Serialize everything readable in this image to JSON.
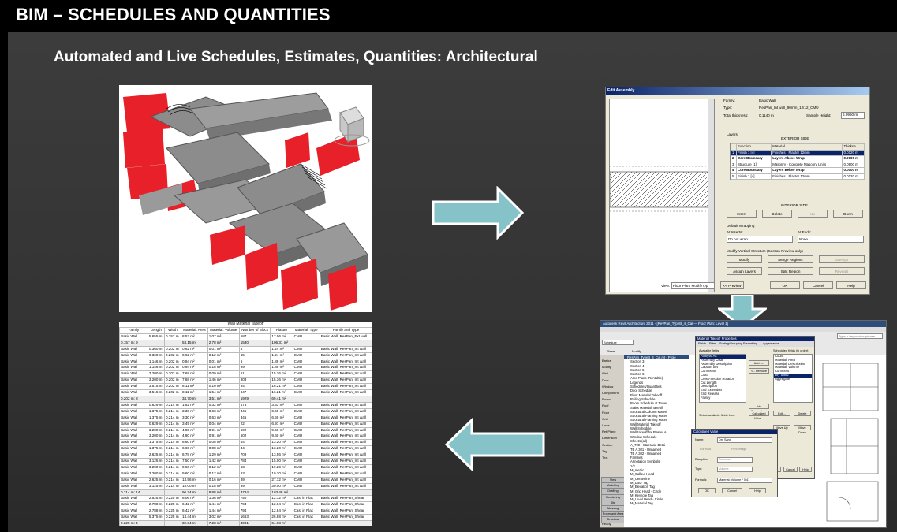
{
  "slide": {
    "title": "BIM – SCHEDULES AND QUANTITIES",
    "subtitle": "Automated and Live Schedules, Estimates, Quantities: Architectural"
  },
  "schedule": {
    "title": "Wall Material Takeoff",
    "headers": [
      "Family",
      "Length",
      "Width",
      "Material: Area",
      "Material: Volume",
      "Number of Block",
      "Plaster",
      "Material: Type",
      "Family and Type"
    ],
    "rows": [
      [
        "Basic Wall",
        "5.655 m",
        "0.157 m",
        "8.53 m²",
        "1.07 m³",
        "587",
        "17.06 m²",
        "CMU",
        "Basic Wall: ResPan_Ext wall"
      ],
      [
        "0.157 m: 9",
        "",
        "",
        "53.15 m²",
        "2.78 m³",
        "1530",
        "106.31 m²",
        "",
        ""
      ],
      [
        "Basic Wall",
        "0.360 m",
        "0.202 m",
        "0.62 m²",
        "0.01 m³",
        "4",
        "1.24 m²",
        "CMU",
        "Basic Wall: ResPan_Int wall"
      ],
      [
        "Basic Wall",
        "0.360 m",
        "0.202 m",
        "0.62 m²",
        "0.12 m³",
        "65",
        "1.24 m²",
        "CMU",
        "Basic Wall: ResPan_Int wall"
      ],
      [
        "Basic Wall",
        "1.146 m",
        "0.202 m",
        "0.94 m²",
        "0.01 m³",
        "6",
        "1.89 m²",
        "CMU",
        "Basic Wall: ResPan_Int wall"
      ],
      [
        "Basic Wall",
        "1.146 m",
        "0.202 m",
        "0.94 m²",
        "0.18 m³",
        "99",
        "1.89 m²",
        "CMU",
        "Basic Wall: ResPan_Int wall"
      ],
      [
        "Basic Wall",
        "3.200 m",
        "0.202 m",
        "7.68 m²",
        "0.09 m³",
        "51",
        "15.36 m²",
        "CMU",
        "Basic Wall: ResPan_Int wall"
      ],
      [
        "Basic Wall",
        "3.200 m",
        "0.202 m",
        "7.68 m²",
        "1.46 m³",
        "803",
        "15.36 m²",
        "CMU",
        "Basic Wall: ResPan_Int wall"
      ],
      [
        "Basic Wall",
        "3.515 m",
        "0.202 m",
        "8.11 m²",
        "0.10 m³",
        "54",
        "16.21 m²",
        "CMU",
        "Basic Wall: ResPan_Int wall"
      ],
      [
        "Basic Wall",
        "3.515 m",
        "0.202 m",
        "8.11 m²",
        "1.54 m³",
        "847",
        "16.21 m²",
        "CMU",
        "Basic Wall: ResPan_Int wall"
      ],
      [
        "0.202 m: 8",
        "",
        "",
        "34.70 m²",
        "3.51 m³",
        "1929",
        "69.41 m²",
        "",
        ""
      ],
      [
        "Basic Wall",
        "0.629 m",
        "0.214 m",
        "1.82 m²",
        "0.32 m³",
        "173",
        "3.63 m²",
        "CMU",
        "Basic Wall: ResPan_Int wall"
      ],
      [
        "Basic Wall",
        "1.375 m",
        "0.214 m",
        "3.30 m²",
        "0.63 m³",
        "345",
        "6.60 m²",
        "CMU",
        "Basic Wall: ResPan_Int wall"
      ],
      [
        "Basic Wall",
        "1.375 m",
        "0.214 m",
        "3.30 m²",
        "0.63 m³",
        "345",
        "6.60 m²",
        "CMU",
        "Basic Wall: ResPan_Int wall"
      ],
      [
        "Basic Wall",
        "0.629 m",
        "0.214 m",
        "3.49 m²",
        "0.04 m³",
        "22",
        "6.97 m²",
        "CMU",
        "Basic Wall: ResPan_Int wall"
      ],
      [
        "Basic Wall",
        "3.200 m",
        "0.214 m",
        "4.80 m²",
        "0.91 m³",
        "502",
        "9.60 m²",
        "CMU",
        "Basic Wall: ResPan_Int wall"
      ],
      [
        "Basic Wall",
        "3.200 m",
        "0.214 m",
        "4.80 m²",
        "0.91 m³",
        "502",
        "9.60 m²",
        "CMU",
        "Basic Wall: ResPan_Int wall"
      ],
      [
        "Basic Wall",
        "1.375 m",
        "0.214 m",
        "6.60 m²",
        "0.08 m³",
        "44",
        "13.20 m²",
        "CMU",
        "Basic Wall: ResPan_Int wall"
      ],
      [
        "Basic Wall",
        "1.375 m",
        "0.214 m",
        "6.60 m²",
        "0.08 m³",
        "44",
        "13.20 m²",
        "CMU",
        "Basic Wall: ResPan_Int wall"
      ],
      [
        "Basic Wall",
        "2.625 m",
        "0.214 m",
        "6.78 m²",
        "1.29 m³",
        "709",
        "13.56 m²",
        "CMU",
        "Basic Wall: ResPan_Int wall"
      ],
      [
        "Basic Wall",
        "3.125 m",
        "0.214 m",
        "7.50 m²",
        "1.42 m³",
        "784",
        "15.00 m²",
        "CMU",
        "Basic Wall: ResPan_Int wall"
      ],
      [
        "Basic Wall",
        "3.200 m",
        "0.214 m",
        "9.60 m²",
        "0.12 m³",
        "63",
        "19.20 m²",
        "CMU",
        "Basic Wall: ResPan_Int wall"
      ],
      [
        "Basic Wall",
        "3.200 m",
        "0.214 m",
        "9.60 m²",
        "0.12 m³",
        "63",
        "19.20 m²",
        "CMU",
        "Basic Wall: ResPan_Int wall"
      ],
      [
        "Basic Wall",
        "2.625 m",
        "0.214 m",
        "13.56 m²",
        "0.16 m³",
        "89",
        "27.12 m²",
        "CMU",
        "Basic Wall: ResPan_Int wall"
      ],
      [
        "Basic Wall",
        "3.125 m",
        "0.214 m",
        "15.00 m²",
        "0.18 m³",
        "99",
        "30.00 m²",
        "CMU",
        "Basic Wall: ResPan_Int wall"
      ],
      [
        "0.214 m: 14",
        "",
        "",
        "96.74 m²",
        "8.88 m³",
        "3784",
        "193.48 m²",
        "",
        ""
      ],
      [
        "Basic Wall",
        "2.525 m",
        "0.225 m",
        "6.06 m²",
        "1.36 m³",
        "750",
        "12.12 m²",
        "Cast in Plac",
        "Basic Wall: ResPan_Shear"
      ],
      [
        "Basic Wall",
        "2.788 m",
        "0.225 m",
        "6.42 m²",
        "1.44 m³",
        "794",
        "12.84 m²",
        "Cast in Plac",
        "Basic Wall: ResPan_Shear"
      ],
      [
        "Basic Wall",
        "2.788 m",
        "0.225 m",
        "6.42 m²",
        "1.44 m³",
        "794",
        "12.84 m²",
        "Cast in Plac",
        "Basic Wall: ResPan_Shear"
      ],
      [
        "Basic Wall",
        "5.375 m",
        "0.225 m",
        "13.44 m²",
        "3.02 m³",
        "1663",
        "26.88 m²",
        "Cast in Plac",
        "Basic Wall: ResPan_Shear"
      ],
      [
        "0.225 m: 4",
        "",
        "",
        "32.34 m²",
        "7.28 m³",
        "4001",
        "64.68 m²",
        "",
        ""
      ],
      [
        "Grand total: 97",
        "",
        "",
        "688.76 m²",
        "43.77 m³",
        "24075",
        "1377.51 m²",
        "",
        ""
      ]
    ]
  },
  "edit_assembly": {
    "caption": "Edit Assembly",
    "family_label": "Family:",
    "family_value": "Basic Wall",
    "type_label": "Type:",
    "type_value": "ResPan_Int wall_90mm_12/12_CMU",
    "thickness_label": "Total thickness:",
    "thickness_value": "0.1140 m",
    "sample_label": "Sample Height:",
    "sample_value": "6.0960 m",
    "layers_label": "Layers",
    "exterior_side": "EXTERIOR SIDE",
    "interior_side": "INTERIOR SIDE",
    "layer_headers": [
      "",
      "Function",
      "Material",
      "Thickne"
    ],
    "layers": [
      [
        "1",
        "Finish 1 [4]",
        "Finishes - Plaster 12mm",
        "0.0120 m"
      ],
      [
        "2",
        "Core Boundary",
        "Layers Above Wrap",
        "0.0000 m"
      ],
      [
        "3",
        "Structure [1]",
        "Masonry - Concrete Masonry Units",
        "0.0900 m"
      ],
      [
        "4",
        "Core Boundary",
        "Layers Below Wrap",
        "0.0000 m"
      ],
      [
        "5",
        "Finish 1 [4]",
        "Finishes - Plaster 12mm",
        "0.0120 m"
      ]
    ],
    "insert": "Insert",
    "delete": "Delete",
    "up": "Up",
    "down": "Down",
    "default_wrapping": "Default Wrapping",
    "at_inserts_label": "At Inserts:",
    "at_inserts_value": "Do not wrap",
    "at_ends_label": "At Ends:",
    "at_ends_value": "None",
    "modify_vertical": "Modify Vertical Structure (Section Preview only)",
    "modify": "Modify",
    "merge_regions": "Merge Regions",
    "sweeps": "Sweeps",
    "assign_layers": "Assign Layers",
    "split_region": "Split Region",
    "reveals": "Reveals",
    "view_label": "View:",
    "view_value": "Floor Plan: Modify typ",
    "preview": "<< Preview",
    "ok": "OK",
    "cancel": "Cancel",
    "help": "Help"
  },
  "revit": {
    "title": "Autodesk Revit Architecture 2011 - [RevPan_TypeB_4_Cal — Floor Plan: Level 1]",
    "search": "Type a keyword or phrase",
    "schedule_combo": "Schedule",
    "family_label": "Family:",
    "family_value": "System Family: Schedule",
    "toolbar": [
      "Plane",
      "Modify"
    ],
    "left_tools": [
      "Basics",
      "Modify",
      "Wall",
      "Door",
      "Window",
      "Component",
      "Room",
      "Roof",
      "Floor",
      "Grid",
      "Lines",
      "Ref Plane",
      "Dimension",
      "Section",
      "Tag",
      "Text"
    ],
    "left_tabs": [
      "View",
      "Modelling",
      "Drafting",
      "Rendering",
      "Site",
      "Massing",
      "Room and Area",
      "Structural"
    ],
    "tree_title": "ResPan_TypeB_4_Cal.rvt - Proje",
    "tree": [
      "Section 3",
      "Section 4",
      "Section 5",
      "Section 6",
      "Area Plans (Rentable)",
      "Legends",
      "Schedules/Quantities",
      "Door Schedule",
      "Floor Material Takeoff",
      "Railing Schedule",
      "Room Schedule at Tower",
      "Stairs Material Takeoff",
      "Structural Column Materi",
      "Structural Framing Mater",
      "Structural Framing Mater",
      "Wall Material Takeoff",
      "Wall Schedule",
      "Wall takeoff for Plaster A",
      "Window Schedule",
      "Sheets (all)",
      "A_700 - Staircase Detai",
      "TB A.301 - Unnamed",
      "TB A.302 - Unnamed",
      "Families",
      "Annotation Symbols",
      "1/2",
      "M_metric",
      "M_Callout Head",
      "M_Centerline",
      "M_Door Tag",
      "M_Elevation Tag",
      "M_Grid Head - Circle",
      "M_Keynote Tag",
      "M_Level Head - Circle",
      "M_Material Tag"
    ],
    "status": "Ready",
    "props_title": "Material Takeoff Properties",
    "props_tabs": [
      "Fields",
      "Filter",
      "Sorting/Grouping",
      "Formatting",
      "Appearance"
    ],
    "available_label": "Available fields:",
    "scheduled_label": "Scheduled fields (in order):",
    "available": [
      "Analytic As",
      "Assembly Code",
      "Assembly Description",
      "Caption Set",
      "Comments",
      "Cost",
      "Cross-Section Rotation",
      "Cut Length",
      "Description",
      "End Extension",
      "End Release",
      "Family"
    ],
    "scheduled": [
      "Count",
      "Material: Area",
      "Material: Description",
      "Material: Volume",
      "Comment",
      "Dry Sand",
      "Aggregate"
    ],
    "add": "Add -->",
    "remove": "<-- Remove",
    "add_param": "Add Parameter...",
    "calc_value": "Calculated Value...",
    "edit": "Edit...",
    "delete": "Delete",
    "move_up": "Move Up",
    "move_down": "Move Down",
    "select_fields_from": "Select available fields from:",
    "calc_title": "Calculated Value",
    "name_label": "Name:",
    "name_value": "Dry Sand",
    "formula_radio": "Formula",
    "percentage_radio": "Percentage",
    "discipline_label": "Discipline:",
    "discipline_value": "Common",
    "type_label": "Type:",
    "type_value": "Volume",
    "formula_label": "Formula:",
    "formula_value": "Material: Volume * 0.41",
    "ok": "OK",
    "cancel": "Cancel",
    "help": "Help"
  },
  "colors": {
    "arrow_fill": "#85c3c9",
    "arrow_stroke": "#ffffff",
    "wall_red": "#e8202a",
    "slab_gray": "#8c8c8c"
  }
}
